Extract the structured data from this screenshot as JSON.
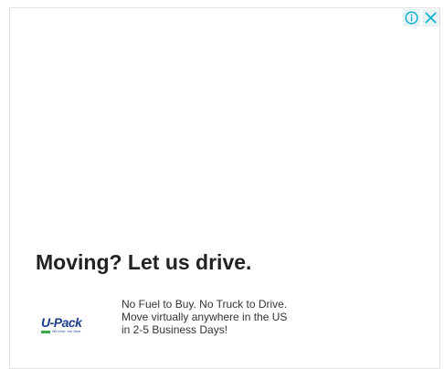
{
  "ad": {
    "headline": "Moving? Let us drive.",
    "body_lines": [
      "No Fuel to Buy. No Truck to Drive.",
      "Move virtually anywhere in the US",
      "in 2-5 Business Days!"
    ],
    "logo": {
      "name": "U-Pack",
      "tagline": "We Drive. You Save."
    }
  },
  "adchoices": {
    "info_icon": "info-icon",
    "close_icon": "close-icon",
    "accent": "#00aecd"
  },
  "colors": {
    "headline": "#222222",
    "body": "#333333",
    "logo_blue": "#1d3f8a",
    "logo_green": "#3aa84b"
  }
}
